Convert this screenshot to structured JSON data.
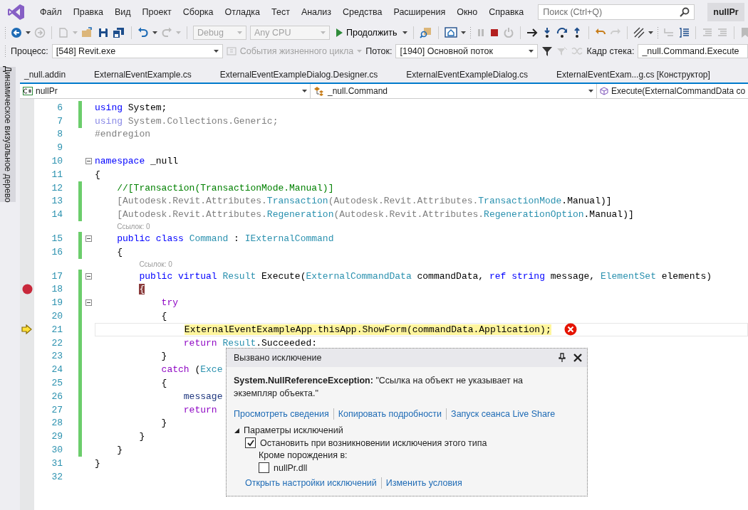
{
  "menu": [
    "Файл",
    "Правка",
    "Вид",
    "Проект",
    "Сборка",
    "Отладка",
    "Тест",
    "Анализ",
    "Средства",
    "Расширения",
    "Окно",
    "Справка"
  ],
  "search": {
    "placeholder": "Поиск (Ctrl+Q)"
  },
  "solution_badge": "nullPr",
  "toolbar": {
    "configuration": "Debug",
    "platform": "Any CPU",
    "continue": "Продолжить"
  },
  "debug_location": {
    "process_label": "Процесс:",
    "process": "[548] Revit.exe",
    "lifecycle": "События жизненного цикла",
    "thread_label": "Поток:",
    "thread": "[1940] Основной поток",
    "stack_label": "Кадр стека:",
    "stack_frame": "_null.Command.Execute"
  },
  "side_tab": "Динамическое визуальное дерево",
  "tabs": [
    {
      "label": "_null.addin",
      "selected": false
    },
    {
      "label": "ExternalEventExample.cs",
      "selected": false
    },
    {
      "label": "ExternalEventExampleDialog.Designer.cs",
      "selected": false
    },
    {
      "label": "ExternalEventExampleDialog.cs",
      "selected": false
    },
    {
      "label": "ExternalEventExam...g.cs [Конструктор]",
      "selected": false
    }
  ],
  "navigation": {
    "project": "nullPr",
    "type": "_null.Command",
    "member": "Execute(ExternalCommandData co"
  },
  "lines": [
    {
      "number": "6",
      "changed": true,
      "fold": false,
      "breakpoint": false,
      "current": false,
      "error": false,
      "tokens": [
        {
          "kind": "keyword",
          "text": "using"
        },
        {
          "kind": "plain",
          "text": " System;"
        }
      ]
    },
    {
      "number": "7",
      "changed": true,
      "fold": false,
      "breakpoint": false,
      "current": false,
      "error": false,
      "tokens": [
        {
          "kind": "faded-keyword",
          "text": "using"
        },
        {
          "kind": "gray",
          "text": " System.Collections.Generic;"
        }
      ]
    },
    {
      "number": "8",
      "changed": false,
      "fold": false,
      "breakpoint": false,
      "current": false,
      "error": false,
      "tokens": [
        {
          "kind": "gray",
          "text": "#endregion"
        }
      ]
    },
    {
      "number": "9",
      "changed": false,
      "fold": false,
      "breakpoint": false,
      "current": false,
      "error": false
    },
    {
      "number": "10",
      "changed": false,
      "fold": true,
      "breakpoint": false,
      "current": false,
      "error": false,
      "tokens": [
        {
          "kind": "keyword",
          "text": "namespace"
        },
        {
          "kind": "plain",
          "text": " _null"
        }
      ]
    },
    {
      "number": "11",
      "changed": false,
      "fold": false,
      "breakpoint": false,
      "current": false,
      "error": false,
      "tokens": [
        {
          "kind": "plain",
          "text": "{"
        }
      ]
    },
    {
      "number": "12",
      "changed": true,
      "fold": false,
      "breakpoint": false,
      "current": false,
      "error": false,
      "tokens": [
        {
          "kind": "comment",
          "text": "    //[Transaction(TransactionMode.Manual)]"
        }
      ]
    },
    {
      "number": "13",
      "changed": true,
      "fold": false,
      "breakpoint": false,
      "current": false,
      "error": false,
      "tokens": [
        {
          "kind": "gray",
          "text": "    [Autodesk.Revit.Attributes."
        },
        {
          "kind": "type",
          "text": "Transaction"
        },
        {
          "kind": "gray",
          "text": "(Autodesk.Revit.Attributes."
        },
        {
          "kind": "type",
          "text": "TransactionMode"
        },
        {
          "kind": "plain",
          "text": ".Manual)]"
        }
      ]
    },
    {
      "number": "14",
      "changed": true,
      "fold": false,
      "breakpoint": false,
      "current": false,
      "error": false,
      "tokens": [
        {
          "kind": "gray",
          "text": "    [Autodesk.Revit.Attributes."
        },
        {
          "kind": "type",
          "text": "Regeneration"
        },
        {
          "kind": "gray",
          "text": "(Autodesk.Revit.Attributes."
        },
        {
          "kind": "type",
          "text": "RegenerationOption"
        },
        {
          "kind": "plain",
          "text": ".Manual)]"
        }
      ]
    },
    {
      "number": "15",
      "codelens": "Ссылок: 0",
      "changed": true,
      "fold": true,
      "breakpoint": false,
      "current": false,
      "error": false,
      "tokens": [
        {
          "kind": "keyword",
          "text": "    public class"
        },
        {
          "kind": "type",
          "text": " Command"
        },
        {
          "kind": "plain",
          "text": " : "
        },
        {
          "kind": "type",
          "text": "IExternalCommand"
        }
      ]
    },
    {
      "number": "16",
      "changed": true,
      "fold": false,
      "breakpoint": false,
      "current": false,
      "error": false,
      "tokens": [
        {
          "kind": "plain",
          "text": "    {"
        }
      ]
    },
    {
      "number": "17",
      "codelens": "Ссылок: 0",
      "changed": true,
      "fold": true,
      "breakpoint": false,
      "current": false,
      "error": false,
      "tokens": [
        {
          "kind": "keyword",
          "text": "        public virtual"
        },
        {
          "kind": "type",
          "text": " Result"
        },
        {
          "kind": "plain",
          "text": " Execute("
        },
        {
          "kind": "type",
          "text": "ExternalCommandData"
        },
        {
          "kind": "plain",
          "text": " commandData, "
        },
        {
          "kind": "keyword",
          "text": "ref string"
        },
        {
          "kind": "plain",
          "text": " message, "
        },
        {
          "kind": "type",
          "text": "ElementSet"
        },
        {
          "kind": "plain",
          "text": " elements)"
        }
      ]
    },
    {
      "number": "18",
      "changed": true,
      "fold": false,
      "breakpoint": true,
      "current": false,
      "error": false,
      "tokens": [
        {
          "kind": "breakpoint",
          "text": "        {"
        }
      ]
    },
    {
      "number": "19",
      "changed": true,
      "fold": true,
      "breakpoint": false,
      "current": false,
      "error": false,
      "tokens": [
        {
          "kind": "control",
          "text": "            try"
        }
      ]
    },
    {
      "number": "20",
      "changed": true,
      "fold": false,
      "breakpoint": false,
      "current": false,
      "error": false,
      "tokens": [
        {
          "kind": "plain",
          "text": "            {"
        }
      ]
    },
    {
      "number": "21",
      "changed": true,
      "fold": false,
      "breakpoint": false,
      "current": true,
      "error": true,
      "tokens": [
        {
          "kind": "current",
          "text": "                ExternalEventExampleApp.thisApp.ShowForm(commandData.Application);"
        }
      ]
    },
    {
      "number": "22",
      "changed": true,
      "fold": false,
      "breakpoint": false,
      "current": false,
      "error": false,
      "tokens": [
        {
          "kind": "control",
          "text": "                return"
        },
        {
          "kind": "type",
          "text": " Result"
        },
        {
          "kind": "plain",
          "text": ".Succeeded:"
        }
      ]
    },
    {
      "number": "23",
      "changed": true,
      "fold": false,
      "breakpoint": false,
      "current": false,
      "error": false,
      "tokens": [
        {
          "kind": "plain",
          "text": "            }"
        }
      ]
    },
    {
      "number": "24",
      "changed": true,
      "fold": false,
      "breakpoint": false,
      "current": false,
      "error": false,
      "tokens": [
        {
          "kind": "control",
          "text": "            catch"
        },
        {
          "kind": "plain",
          "text": " ("
        },
        {
          "kind": "type",
          "text": "Exce"
        }
      ]
    },
    {
      "number": "25",
      "changed": true,
      "fold": false,
      "breakpoint": false,
      "current": false,
      "error": false,
      "tokens": [
        {
          "kind": "plain",
          "text": "            {"
        }
      ]
    },
    {
      "number": "26",
      "changed": true,
      "fold": false,
      "breakpoint": false,
      "current": false,
      "error": false,
      "tokens": [
        {
          "kind": "local",
          "text": "                message"
        }
      ]
    },
    {
      "number": "27",
      "changed": true,
      "fold": false,
      "breakpoint": false,
      "current": false,
      "error": false,
      "tokens": [
        {
          "kind": "control",
          "text": "                return"
        }
      ]
    },
    {
      "number": "28",
      "changed": true,
      "fold": false,
      "breakpoint": false,
      "current": false,
      "error": false,
      "tokens": [
        {
          "kind": "plain",
          "text": "            }"
        }
      ]
    },
    {
      "number": "29",
      "changed": true,
      "fold": false,
      "breakpoint": false,
      "current": false,
      "error": false,
      "tokens": [
        {
          "kind": "plain",
          "text": "        }"
        }
      ]
    },
    {
      "number": "30",
      "changed": true,
      "fold": false,
      "breakpoint": false,
      "current": false,
      "error": false,
      "tokens": [
        {
          "kind": "plain",
          "text": "    }"
        }
      ]
    },
    {
      "number": "31",
      "changed": false,
      "fold": false,
      "breakpoint": false,
      "current": false,
      "error": false,
      "tokens": [
        {
          "kind": "plain",
          "text": "}"
        }
      ]
    },
    {
      "number": "32",
      "changed": false,
      "fold": false,
      "breakpoint": false,
      "current": false,
      "error": false
    }
  ],
  "exception_popup": {
    "title": "Вызвано исключение",
    "message": "**System.NullReferenceException:** \"Ссылка на объект не указывает на экземпляр объекта.\"",
    "links": [
      "Просмотреть сведения",
      "Копировать подробности",
      "Запуск сеанса Live Share"
    ],
    "settings": {
      "label": "Параметры исключений",
      "expanded": true,
      "break_option": {
        "label": "Остановить при возникновении исключения этого типа",
        "checked": true
      },
      "except_label": "Кроме порождения в:",
      "modules": [
        {
          "label": "nullPr.dll",
          "checked": false
        }
      ]
    },
    "footer_links": [
      "Открыть настройки исключений",
      "Изменить условия"
    ]
  }
}
